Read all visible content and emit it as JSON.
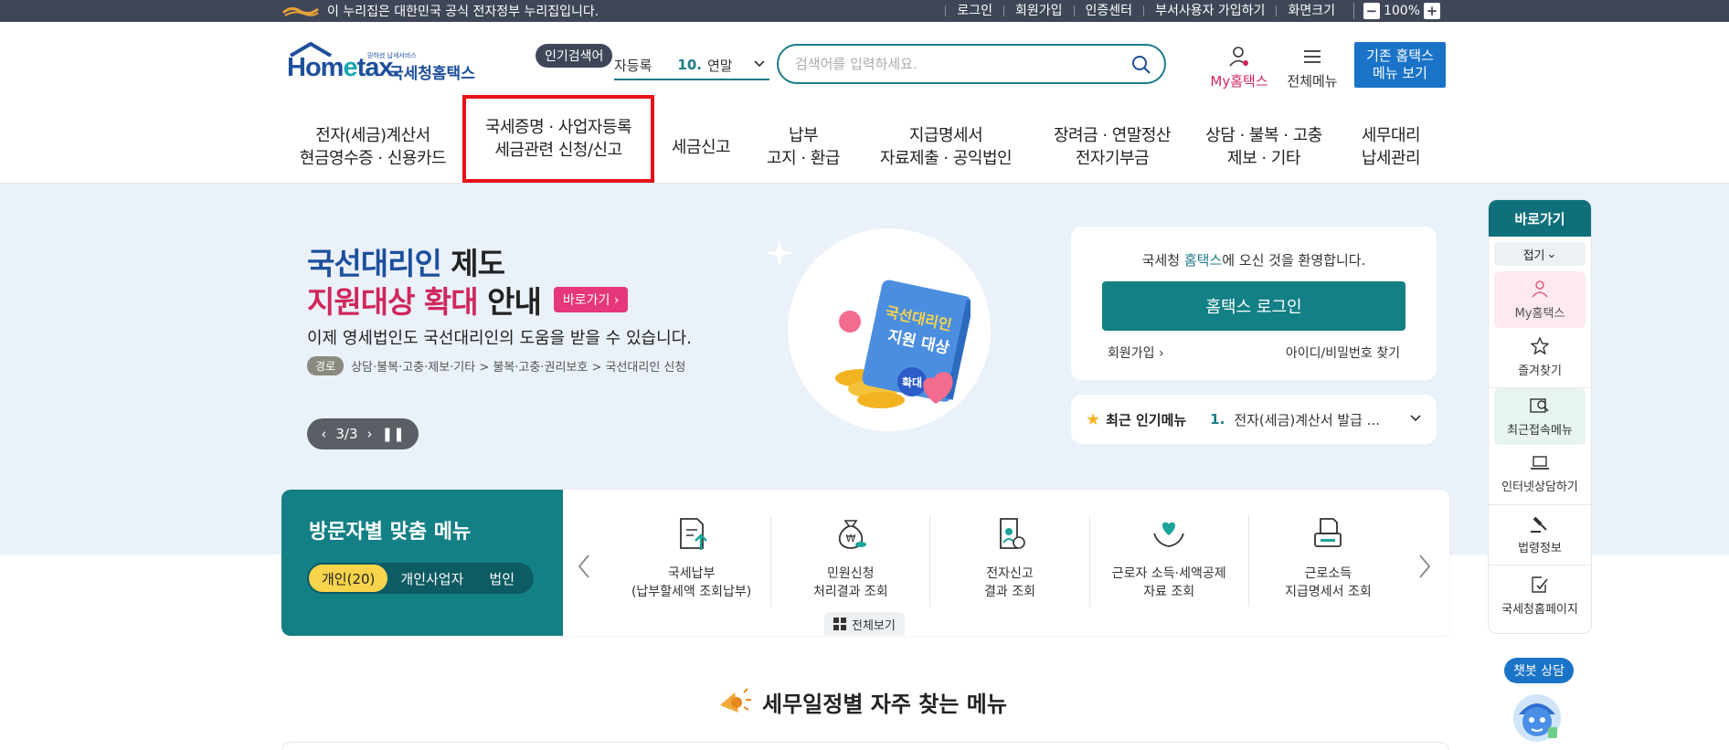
{
  "gov_bar": {
    "notice": "이 누리집은 대한민국 공식 전자정부 누리집입니다.",
    "links": [
      "로그인",
      "회원가입",
      "인증센터",
      "부서사용자 가입하기",
      "화면크기"
    ],
    "zoom_value": "100%",
    "zoom_minus": "−",
    "zoom_plus": "+"
  },
  "header": {
    "logo_word": "Hom",
    "logo_e": "e",
    "logo_word2": "tax.",
    "logo_tiny": "믿하셨 납세서비스",
    "logo_kor": "국세청홈택스",
    "popular_badge": "인기검색어",
    "popular_label": "자등록",
    "popular_rank": "10.",
    "popular_text": "연말",
    "search_placeholder": "검색어를 입력하세요.",
    "my_hometax": "My홈택스",
    "all_menu": "전체메뉴",
    "classic_line1": "기존 홈택스",
    "classic_line2": "메뉴 보기"
  },
  "nav": [
    {
      "l1": "전자(세금)계산서",
      "l2": "현금영수증 · 신용카드"
    },
    {
      "l1": "국세증명 · 사업자등록",
      "l2": "세금관련 신청/신고"
    },
    {
      "l1": "세금신고",
      "l2": ""
    },
    {
      "l1": "납부",
      "l2": "고지 · 환급"
    },
    {
      "l1": "지급명세서",
      "l2": "자료제출 · 공익법인"
    },
    {
      "l1": "장려금 · 연말정산",
      "l2": "전자기부금"
    },
    {
      "l1": "상담 · 불복 · 고충",
      "l2": "제보 · 기타"
    },
    {
      "l1": "세무대리",
      "l2": "납세관리"
    }
  ],
  "hero": {
    "t1_blue": "국선대리인",
    "t1_rest": " 제도",
    "t2_red": "지원대상 확대",
    "t2_rest": " 안내",
    "go_btn": "바로가기",
    "sub": "이제 영세법인도 국선대리인의 도움을 받을 수 있습니다.",
    "path_tag": "경로",
    "path": "상담·불복·고충·제보·기타 > 불복·고충·권리보호 > 국선대리인 신청",
    "pager": "3/3",
    "book_title1": "국선대리인",
    "book_title2": "지원 대상",
    "book_badge": "확대"
  },
  "login": {
    "welcome_pre": "국세청 ",
    "welcome_teal": "홈택스",
    "welcome_post": "에 오신 것을 환영합니다.",
    "login_btn": "홈택스 로그인",
    "join": "회원가입",
    "find": "아이디/비밀번호 찾기"
  },
  "recent": {
    "title": "최근 인기메뉴",
    "rank": "1.",
    "item": "전자(세금)계산서 발급 ..."
  },
  "quick": {
    "title": "바로가기",
    "fold": "접기",
    "items": [
      "My홈택스",
      "즐겨찾기",
      "최근접속메뉴",
      "인터넷상담하기",
      "법령정보",
      "국세청홈페이지"
    ]
  },
  "chatbot": "챗봇 상담",
  "visitor": {
    "title": "방문자별 맞춤 메뉴",
    "segments": [
      "개인(20)",
      "개인사업자",
      "법인"
    ],
    "items": [
      {
        "l1": "국세납부",
        "l2": "(납부할세액 조회납부)",
        "icon": "tax-payment-icon"
      },
      {
        "l1": "민원신청",
        "l2": "처리결과 조회",
        "icon": "money-bag-icon"
      },
      {
        "l1": "전자신고",
        "l2": "결과 조회",
        "icon": "document-person-icon"
      },
      {
        "l1": "근로자 소득·세액공제",
        "l2": "자료 조회",
        "icon": "heart-hands-icon"
      },
      {
        "l1": "근로소득",
        "l2": "지급명세서 조회",
        "icon": "printer-doc-icon"
      }
    ],
    "view_all": "전체보기"
  },
  "schedule_title": "세무일정별 자주 찾는 메뉴",
  "colors": {
    "teal": "#138085",
    "nav_highlight": "#e8111a",
    "pink": "#d0275c",
    "classic_blue": "#1a73c7"
  }
}
